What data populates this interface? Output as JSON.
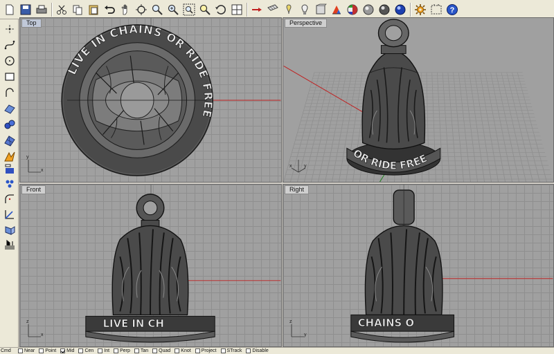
{
  "toolbar": {
    "icons": [
      "new-icon",
      "save-icon",
      "print-icon",
      "cut-icon",
      "copy-icon",
      "paste-icon",
      "undo-icon",
      "pan-icon",
      "rotate-view-icon",
      "zoom-icon",
      "zoom-window-icon",
      "zoom-extents-icon",
      "zoom-selected-icon",
      "undo-view-icon",
      "four-views-icon",
      "show-selection-icon",
      "grid-icon",
      "point-icon",
      "shade-icon",
      "rendered-icon",
      "color-wheel-icon",
      "ghosted-icon",
      "render-icon",
      "options-icon",
      "snapshot-icon",
      "help-icon"
    ]
  },
  "left_tools": [
    "point-tool-icon",
    "curve-tool-icon",
    "circle-tool-icon",
    "rectangle-tool-icon",
    "arc-tool-icon",
    "surface-tool-icon",
    "solid-tool-icon",
    "mesh-tool-icon",
    "transform-tool-icon",
    "dimension-tool-icon",
    "array-tool-icon",
    "fillet-tool-icon",
    "boolean-tool-icon",
    "analyze-tool-icon",
    "render-tool-icon"
  ],
  "viewports": {
    "top": {
      "label": "Top",
      "axis_x": "x",
      "axis_y": "y",
      "ring_text": "LIVE IN CHAINS OR RIDE FREE"
    },
    "perspective": {
      "label": "Perspective",
      "axis_x": "x",
      "axis_y": "y",
      "ring_text": "OR RIDE FREE"
    },
    "front": {
      "label": "Front",
      "axis_x": "x",
      "axis_y": "z",
      "ring_text": "LIVE IN CH"
    },
    "right": {
      "label": "Right",
      "axis_x": "y",
      "axis_y": "z",
      "ring_text": "CHAINS O"
    }
  },
  "statusbar": {
    "command": "Cmd",
    "osnaps": [
      {
        "label": "Near",
        "checked": false
      },
      {
        "label": "Point",
        "checked": false
      },
      {
        "label": "Mid",
        "checked": true
      },
      {
        "label": "Cen",
        "checked": false
      },
      {
        "label": "Int",
        "checked": false
      },
      {
        "label": "Perp",
        "checked": false
      },
      {
        "label": "Tan",
        "checked": false
      },
      {
        "label": "Quad",
        "checked": false
      },
      {
        "label": "Knot",
        "checked": false
      },
      {
        "label": "Project",
        "checked": false
      },
      {
        "label": "STrack",
        "checked": false
      },
      {
        "label": "Disable",
        "checked": false
      }
    ]
  },
  "colors": {
    "viewport_bg": "#a0a0a0",
    "grid_line": "#8f8f8f",
    "x_axis": "#c02020",
    "y_axis": "#208020",
    "model": "#3a3a3a"
  }
}
